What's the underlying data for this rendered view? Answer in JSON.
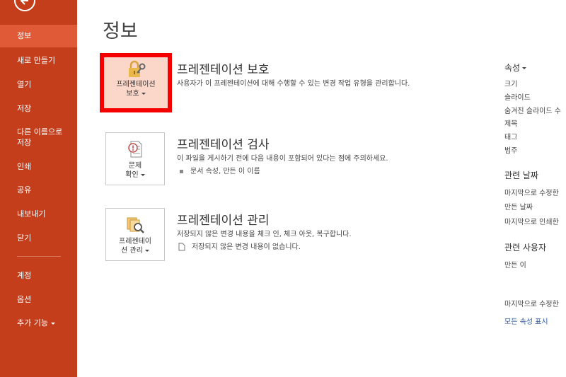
{
  "sidebar": {
    "items": [
      {
        "label": "정보"
      },
      {
        "label": "새로 만들기"
      },
      {
        "label": "열기"
      },
      {
        "label": "저장"
      },
      {
        "label": "다른 이름으로 저장"
      },
      {
        "label": "인쇄"
      },
      {
        "label": "공유"
      },
      {
        "label": "내보내기"
      },
      {
        "label": "닫기"
      },
      {
        "label": "계정"
      },
      {
        "label": "옵션"
      },
      {
        "label": "추가 기능"
      }
    ]
  },
  "main": {
    "title": "정보",
    "protect": {
      "button_line1": "프레젠테이션",
      "button_line2": "보호",
      "title": "프레젠테이션 보호",
      "desc": "사용자가 이 프레젠테이션에 대해 수행할 수 있는 변경 작업 유형을 관리합니다."
    },
    "inspect": {
      "button_line1": "문제",
      "button_line2": "확인",
      "title": "프레젠테이션 검사",
      "desc": "이 파일을 게시하기 전에 다음 내용이 포함되어 있다는 점에 주의하세요.",
      "bullet": "문서 속성, 만든 이 이름"
    },
    "manage": {
      "button_line1": "프레젠테이",
      "button_line2": "션 관리",
      "title": "프레젠테이션 관리",
      "desc": "저장되지 않은 변경 내용을 체크 인, 체크 아웃, 복구합니다.",
      "bullet": "저장되지 않은 변경 내용이 없습니다."
    }
  },
  "properties": {
    "head": "속성",
    "items": [
      "크기",
      "슬라이드",
      "숨겨진 슬라이드 수",
      "제목",
      "태그",
      "범주"
    ],
    "dates_head": "관련 날짜",
    "dates": [
      "마지막으로 수정한",
      "만든 날짜",
      "마지막으로 인쇄한"
    ],
    "people_head": "관련 사용자",
    "people": [
      "만든 이"
    ],
    "last_modified_by": "마지막으로 수정한",
    "show_all": "모든 속성 표시"
  },
  "colors": {
    "sidebar": "#c43e1c",
    "sidebar_active": "#e05a38",
    "highlight_border": "#f40000",
    "selected_tile": "#fbd7c9",
    "link": "#2b579a"
  }
}
